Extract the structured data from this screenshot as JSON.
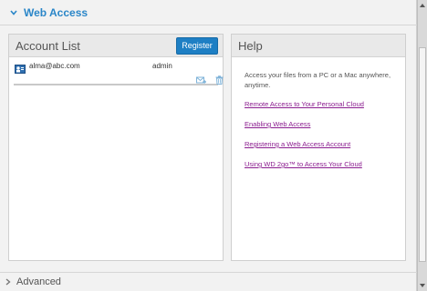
{
  "section": {
    "title": "Web Access"
  },
  "account_list": {
    "title": "Account List",
    "register_label": "Register",
    "accounts": [
      {
        "email": "alma@abc.com",
        "role": "admin"
      }
    ]
  },
  "help": {
    "title": "Help",
    "text": "Access your files from a PC or a Mac anywhere, anytime.",
    "links": [
      "Remote Access to Your Personal Cloud",
      "Enabling Web Access",
      "Registering a Web Access Account",
      "Using WD 2go™ to Access Your Cloud"
    ]
  },
  "advanced": {
    "title": "Advanced"
  },
  "colors": {
    "accent": "#1e7fc4",
    "link": "#8b1d8f",
    "section_title": "#2a86c8"
  }
}
